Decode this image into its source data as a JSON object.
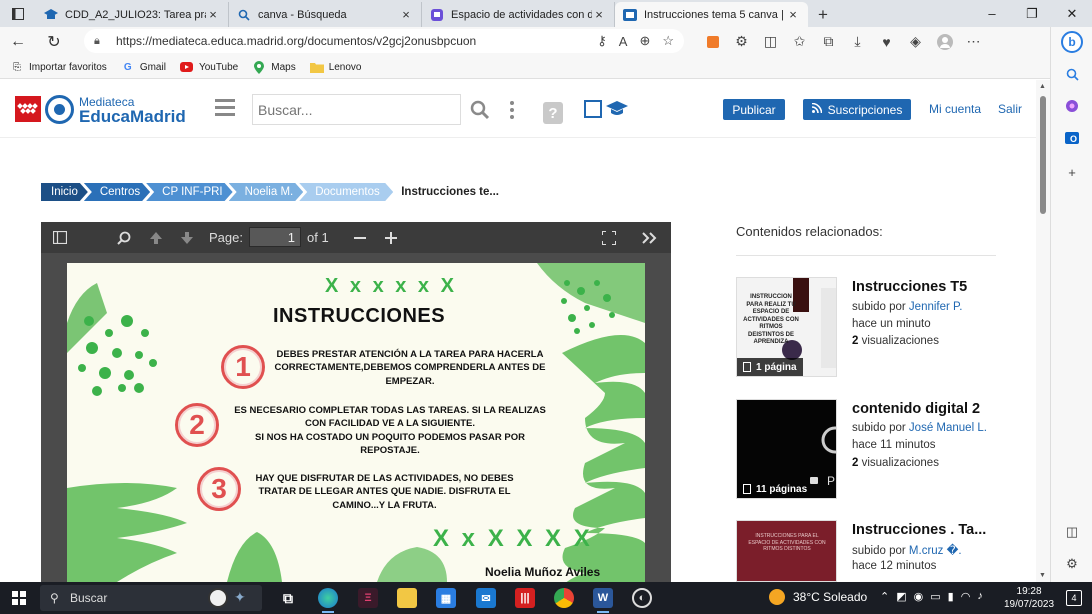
{
  "browser": {
    "tabs": [
      {
        "title": "CDD_A2_JULIO23: Tarea práctica",
        "icon": "graduation-cap-icon",
        "active": false
      },
      {
        "title": "canva - Búsqueda",
        "icon": "search-icon",
        "active": false
      },
      {
        "title": "Espacio de actividades con distin",
        "icon": "canva-icon",
        "active": false
      },
      {
        "title": "Instrucciones tema 5 canva | Me",
        "icon": "bookmark-icon",
        "active": true
      }
    ],
    "url": "https://mediateca.educa.madrid.org/documentos/v2gcj2onusbpcuon",
    "bookmarks": [
      {
        "label": "Importar favoritos",
        "icon": "import-icon"
      },
      {
        "label": "Gmail",
        "icon": "google-icon"
      },
      {
        "label": "YouTube",
        "icon": "youtube-icon"
      },
      {
        "label": "Maps",
        "icon": "maps-pin-icon"
      },
      {
        "label": "Lenovo",
        "icon": "folder-icon"
      }
    ]
  },
  "site": {
    "logo_line1": "Mediateca",
    "logo_line2": "EducaMadrid",
    "search_placeholder": "Buscar...",
    "help_glyph": "?",
    "publicar": "Publicar",
    "suscripciones": "Suscripciones",
    "mi_cuenta": "Mi cuenta",
    "salir": "Salir"
  },
  "breadcrumb": {
    "items": [
      "Inicio",
      "Centros",
      "CP INF-PRI",
      "Noelia M.",
      "Documentos"
    ],
    "current": "Instrucciones te..."
  },
  "pdf": {
    "page_label": "Page:",
    "page_value": "1",
    "of_label": "of 1",
    "title": "INSTRUCCIONES",
    "x_marks": "X x x x x X",
    "x_marks_bottom": "X x X X X X",
    "items": [
      {
        "num": "1",
        "text_lines": [
          "DEBES PRESTAR ATENCIÓN A LA TAREA PARA HACERLA",
          "CORRECTAMENTE,DEBEMOS COMPRENDERLA ANTES DE",
          "EMPEZAR."
        ]
      },
      {
        "num": "2",
        "text_lines": [
          "ES NECESARIO COMPLETAR TODAS LAS TAREAS. SI LA REALIZAS",
          "CON FACILIDAD VE A LA SIGUIENTE.",
          "SI NOS HA COSTADO UN POQUITO PODEMOS PASAR POR",
          "REPOSTAJE."
        ]
      },
      {
        "num": "3",
        "text_lines": [
          "HAY QUE DISFRUTAR DE LAS ACTIVIDADES, NO DEBES",
          "TRATAR DE LLEGAR ANTES QUE NADIE. DISFRUTA EL",
          "CAMINO...Y LA FRUTA."
        ]
      }
    ],
    "author": "Noelia Muñoz Aviles"
  },
  "related": {
    "heading": "Contenidos relacionados:",
    "items": [
      {
        "title": "Instrucciones T5",
        "subido_por": "subido por",
        "user": "Jennifer P.",
        "time": "hace un minuto",
        "views_count": "2",
        "views_label": "visualizaciones",
        "badge": "1 página",
        "thumb_text": "INSTRUCCION PARA REALIZ TU ESPACIO DE ACTIVIDADES CON RITMOS DEISTINTOS DE APRENDIZA"
      },
      {
        "title": "contenido digital 2",
        "subido_por": "subido por",
        "user": "José Manuel L.",
        "time": "hace 11 minutos",
        "views_count": "2",
        "views_label": "visualizaciones",
        "badge": "11 páginas",
        "thumb_text": "P"
      },
      {
        "title": "Instrucciones . Ta...",
        "subido_por": "subido por",
        "user": "M.cruz �.",
        "time": "hace 12 minutos",
        "views_count": "",
        "views_label": "",
        "badge": "",
        "thumb_text": "INSTRUCCIONES PARA EL ESPACIO DE ACTIVIDADES CON RITMOS DISTINTOS"
      }
    ]
  },
  "taskbar": {
    "search": "Buscar",
    "weather": "38°C  Soleado",
    "time": "19:28",
    "date": "19/07/2023",
    "notifications": "4"
  },
  "colors": {
    "brand_blue": "#1f67b1",
    "crumb_colors": [
      "#1c4f86",
      "#2b70b8",
      "#4e90d2",
      "#7bb0e0",
      "#a9cdef"
    ],
    "green_accent": "#3cb24a",
    "red_accent": "#e05050"
  }
}
